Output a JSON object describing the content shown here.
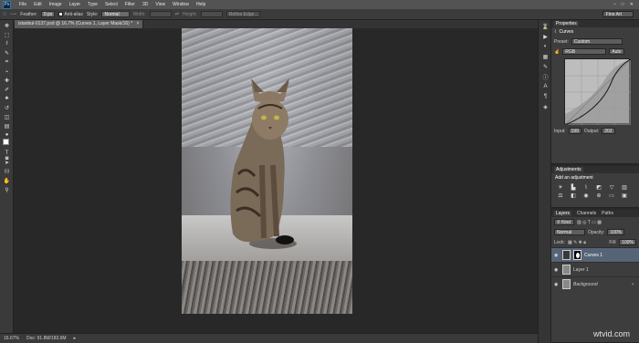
{
  "app": {
    "logo": "Ps"
  },
  "menu": [
    "File",
    "Edit",
    "Image",
    "Layer",
    "Type",
    "Select",
    "Filter",
    "3D",
    "View",
    "Window",
    "Help"
  ],
  "window_controls": [
    "–",
    "□",
    "✕"
  ],
  "options_bar": {
    "feather_label": "Feather:",
    "feather_value": "0 px",
    "antialias_label": "Anti-alias",
    "style_label": "Style:",
    "style_value": "Normal",
    "width_label": "Width:",
    "height_label": "Height:",
    "refine_label": "Refine Edge...",
    "workspace": "Fine Art"
  },
  "document": {
    "tab_title": "istanbul-0137.psd @ 16.7% (Curves 1, Layer Mask/16) *",
    "close": "×"
  },
  "status": {
    "zoom": "16.67%",
    "doc": "Doc: 91.8M/183.6M"
  },
  "properties": {
    "title": "Properties",
    "panel_name": "Curves",
    "preset_label": "Preset:",
    "preset_value": "Custom",
    "channel_value": "RGB",
    "auto_label": "Auto",
    "input_label": "Input:",
    "input_value": "199",
    "output_label": "Output:",
    "output_value": "202"
  },
  "adjustments": {
    "title": "Adjustments",
    "subtitle": "Add an adjustment"
  },
  "layers_panel": {
    "tabs": [
      "Layers",
      "Channels",
      "Paths"
    ],
    "kind_label": "Kind",
    "blend_mode": "Normal",
    "opacity_label": "Opacity:",
    "opacity_value": "100%",
    "lock_label": "Lock:",
    "fill_label": "Fill:",
    "fill_value": "100%",
    "layers": [
      {
        "name": "Curves 1",
        "selected": true
      },
      {
        "name": "Layer 1",
        "selected": false
      },
      {
        "name": "Background",
        "selected": false
      }
    ]
  },
  "watermark": "wtvid.com"
}
